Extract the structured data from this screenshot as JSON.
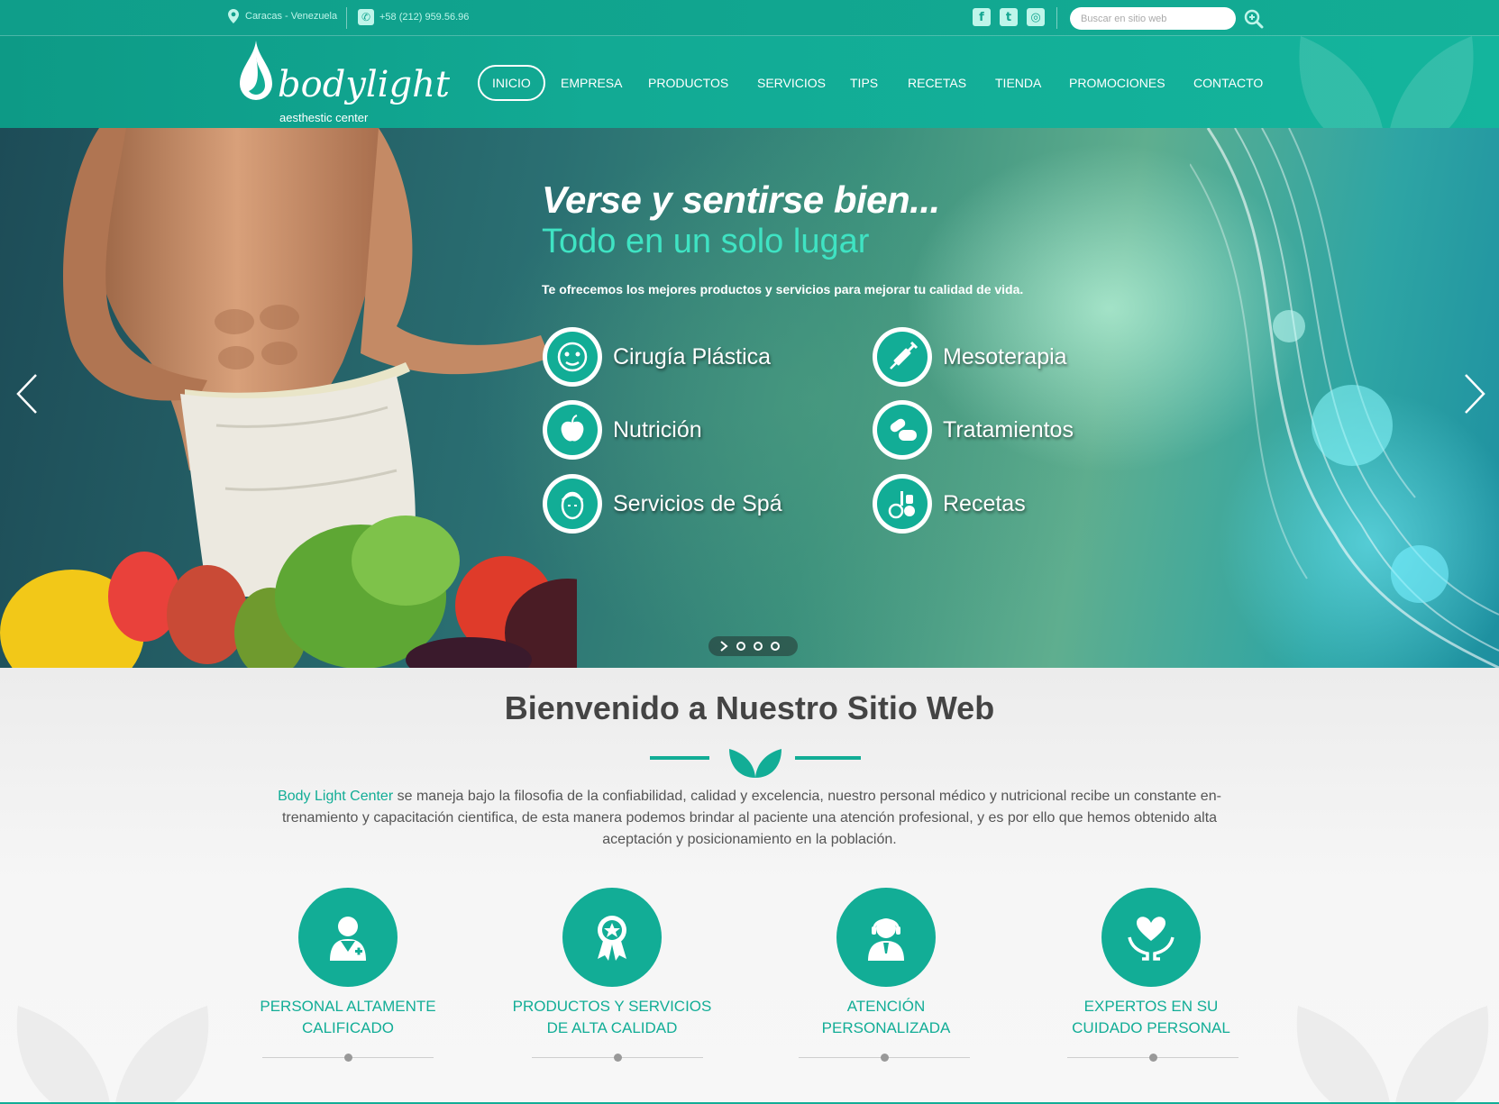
{
  "topbar": {
    "location": "Caracas - Venezuela",
    "phone": "+58 (212) 959.56.96",
    "social": [
      {
        "name": "facebook",
        "glyph": "f"
      },
      {
        "name": "twitter",
        "glyph": "t"
      },
      {
        "name": "instagram",
        "glyph": "◎"
      }
    ],
    "search_placeholder": "Buscar en sitio web"
  },
  "brand": {
    "name": "bodylight",
    "tagline": "aesthestic center"
  },
  "nav": [
    "INICIO",
    "EMPRESA",
    "PRODUCTOS",
    "SERVICIOS",
    "TIPS",
    "RECETAS",
    "TIENDA",
    "PROMOCIONES",
    "CONTACTO"
  ],
  "hero": {
    "title": "Verse y sentirse bien...",
    "subtitle": "Todo en un solo lugar",
    "text": "Te ofrecemos los mejores productos y servicios para mejorar tu calidad de vida.",
    "services": [
      {
        "label": "Cirugía Plástica",
        "icon": "face-icon"
      },
      {
        "label": "Mesoterapia",
        "icon": "syringe-icon"
      },
      {
        "label": "Nutrición",
        "icon": "apple-icon"
      },
      {
        "label": "Tratamientos",
        "icon": "pills-icon"
      },
      {
        "label": "Servicios de Spá",
        "icon": "spa-mask-icon"
      },
      {
        "label": "Recetas",
        "icon": "recipe-icon"
      }
    ],
    "slides_count": 3
  },
  "welcome": {
    "title": "Bienvenido a Nuestro Sitio Web",
    "highlight": "Body Light Center",
    "text": " se maneja bajo la filosofia de la confiabilidad, calidad y excelencia, nuestro personal médico y nutricional recibe un constante en-trenamiento y capacitación cientifica, de esta manera podemos brindar al paciente una atención profesional, y es por ello que hemos obtenido alta aceptación y posicionamiento en la población.",
    "features": [
      {
        "line1": "PERSONAL ALTAMENTE",
        "line2": "CALIFICADO",
        "icon": "doctor-icon"
      },
      {
        "line1": "PRODUCTOS Y SERVICIOS",
        "line2": "DE ALTA CALIDAD",
        "icon": "award-ribbon-icon"
      },
      {
        "line1": "ATENCIÓN",
        "line2": "PERSONALIZADA",
        "icon": "support-agent-icon"
      },
      {
        "line1": "EXPERTOS EN SU",
        "line2": "CUIDADO PERSONAL",
        "icon": "heart-hands-icon"
      }
    ]
  },
  "colors": {
    "accent": "#12ad96",
    "accent_light": "#3fe3c3",
    "text": "#555555"
  }
}
